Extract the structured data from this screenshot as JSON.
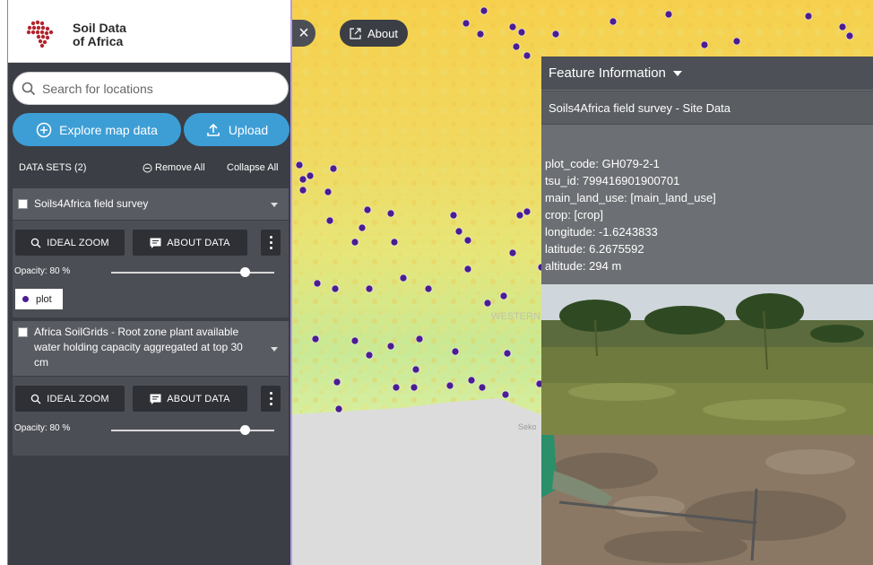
{
  "logo": {
    "line1": "Soil Data",
    "line2": "of Africa"
  },
  "search": {
    "placeholder": "Search for locations"
  },
  "buttons": {
    "explore": "Explore map data",
    "upload": "Upload",
    "about": "About"
  },
  "datasets": {
    "title": "DATA SETS (2)",
    "remove_all": "Remove All",
    "collapse_all": "Collapse All"
  },
  "layers": [
    {
      "name": "Soils4Africa field survey",
      "ideal_zoom": "IDEAL ZOOM",
      "about_data": "ABOUT DATA",
      "opacity": "Opacity: 80 %",
      "opacity_value": 0.8,
      "legend": "plot"
    },
    {
      "name": "Africa SoilGrids - Root zone plant available water holding capacity aggregated at top 30 cm",
      "ideal_zoom": "IDEAL ZOOM",
      "about_data": "ABOUT DATA",
      "opacity": "Opacity: 80 %",
      "opacity_value": 0.8
    }
  ],
  "map": {
    "labels": [
      "WESTERN NORTH REGION",
      "Seko"
    ]
  },
  "feature": {
    "header": "Feature Information",
    "subtitle": "Soils4Africa field survey - Site Data",
    "attributes": [
      "plot_code: GH079-2-1",
      "tsu_id: 799416901900701",
      "main_land_use: [main_land_use]",
      "crop: [crop]",
      "longitude: -1.6243833",
      "latitude: 6.2675592",
      "altitude: 294 m"
    ]
  },
  "colors": {
    "accent": "#3d9ed6",
    "panel_dark": "#3b3e44",
    "point": "#4b1d8f"
  }
}
